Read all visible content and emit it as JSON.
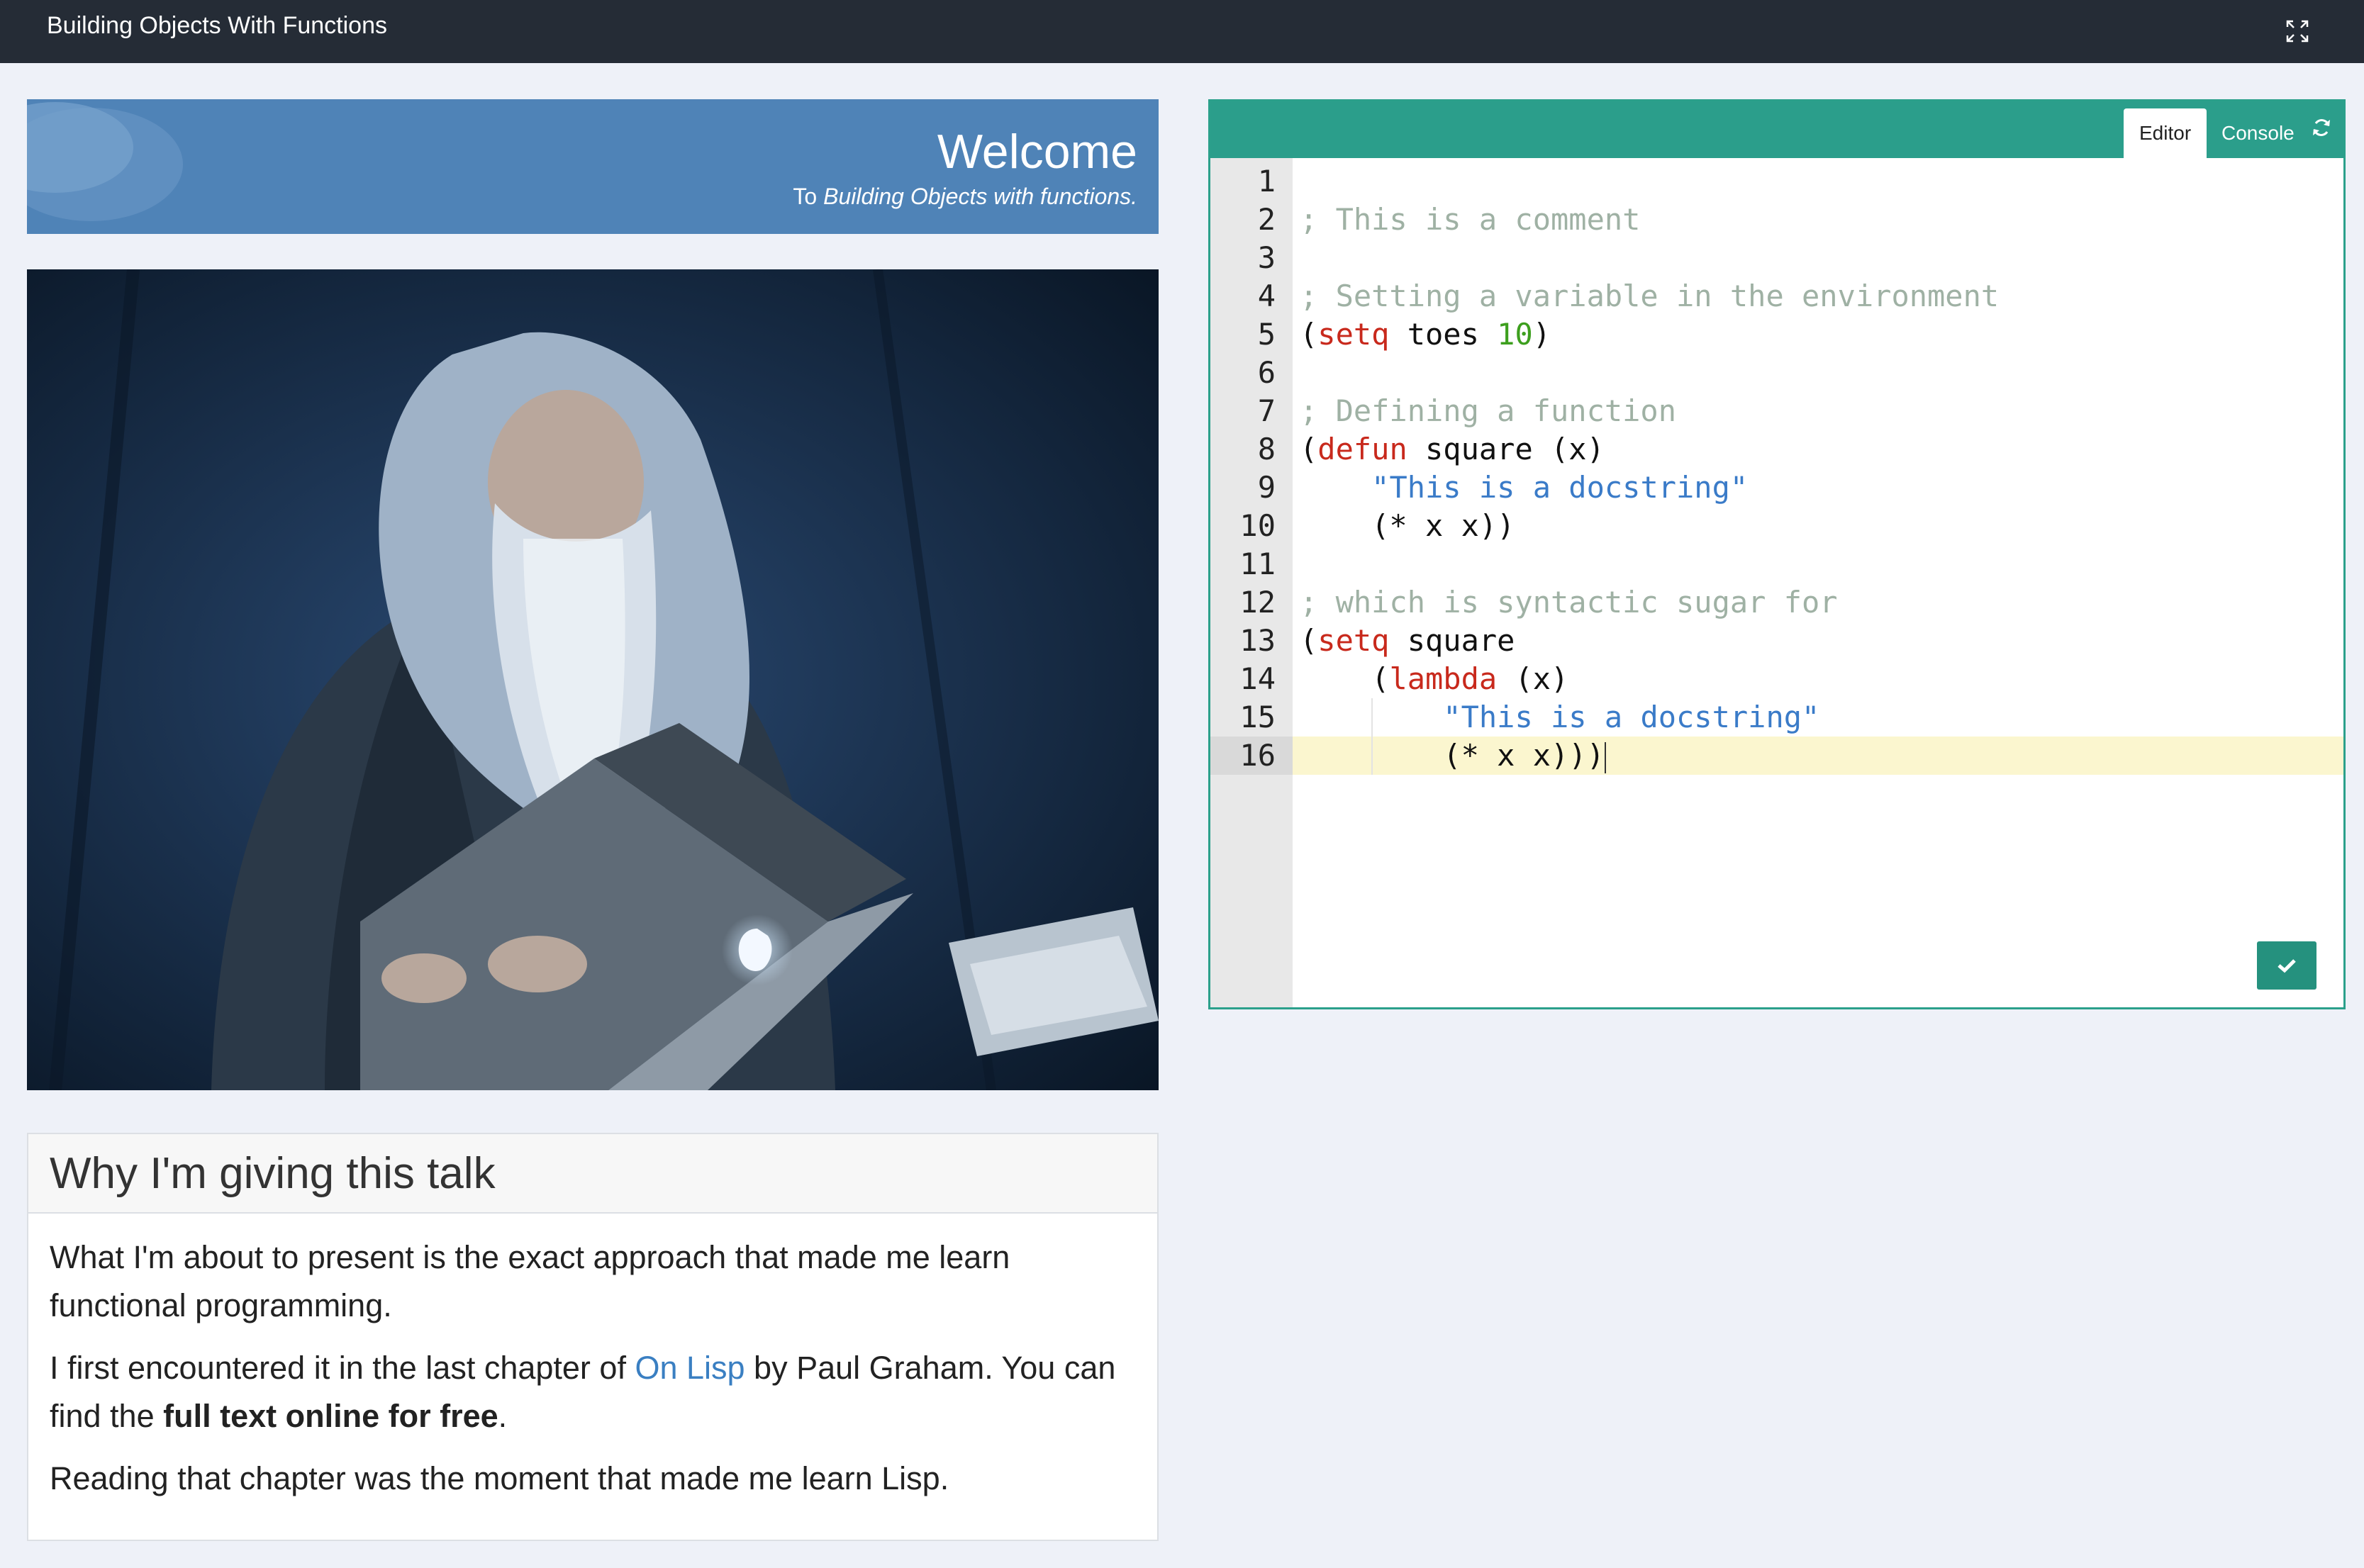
{
  "app": {
    "title": "Building Objects With Functions"
  },
  "icons": {
    "fullscreen": "expand-icon",
    "refresh": "refresh-icon",
    "run": "check-icon"
  },
  "banner": {
    "heading": "Welcome",
    "subtitle_prefix": "To ",
    "subtitle_italic": "Building Objects with functions."
  },
  "photo": {
    "description": "wizard-with-laptop"
  },
  "card": {
    "heading": "Why I'm giving this talk",
    "p1": "What I'm about to present is the exact approach that made me learn functional programming.",
    "p2_before": "I first encountered it in the last chapter of ",
    "p2_link": "On Lisp",
    "p2_middle": " by Paul Graham. You can find the ",
    "p2_bold": "full text online for free",
    "p2_after": ".",
    "p3": "Reading that chapter was the moment that made me learn Lisp."
  },
  "editor": {
    "tabs": {
      "editor": "Editor",
      "console": "Console"
    },
    "active_line": 16,
    "lines": [
      {
        "n": "1"
      },
      {
        "n": "2",
        "comment": "; This is a comment"
      },
      {
        "n": "3"
      },
      {
        "n": "4",
        "comment": "; Setting a variable in the environment"
      },
      {
        "n": "5",
        "p1": "(",
        "kw": "setq",
        "p2": " toes ",
        "num": "10",
        "p3": ")"
      },
      {
        "n": "6"
      },
      {
        "n": "7",
        "comment": "; Defining a function"
      },
      {
        "n": "8",
        "p1": "(",
        "kw": "defun",
        "p2": " square (x)"
      },
      {
        "n": "9",
        "indent": "    ",
        "str": "\"This is a docstring\""
      },
      {
        "n": "10",
        "p1": "    (* x x))"
      },
      {
        "n": "11"
      },
      {
        "n": "12",
        "comment": "; which is syntactic sugar for"
      },
      {
        "n": "13",
        "p1": "(",
        "kw": "setq",
        "p2": " square"
      },
      {
        "n": "14",
        "p1": "    (",
        "kw": "lambda",
        "p2": " (x)"
      },
      {
        "n": "15",
        "indent": "        ",
        "str": "\"This is a docstring\""
      },
      {
        "n": "16",
        "p1": "        (* x x)))"
      }
    ]
  },
  "colors": {
    "topbar": "#252c36",
    "banner": "#4f83b7",
    "editor_accent": "#2b9e8b",
    "comment": "#9fb1a4",
    "keyword": "#c8291c",
    "number": "#3d9f1e",
    "string": "#3a7bc8",
    "link": "#3a7fc2"
  }
}
